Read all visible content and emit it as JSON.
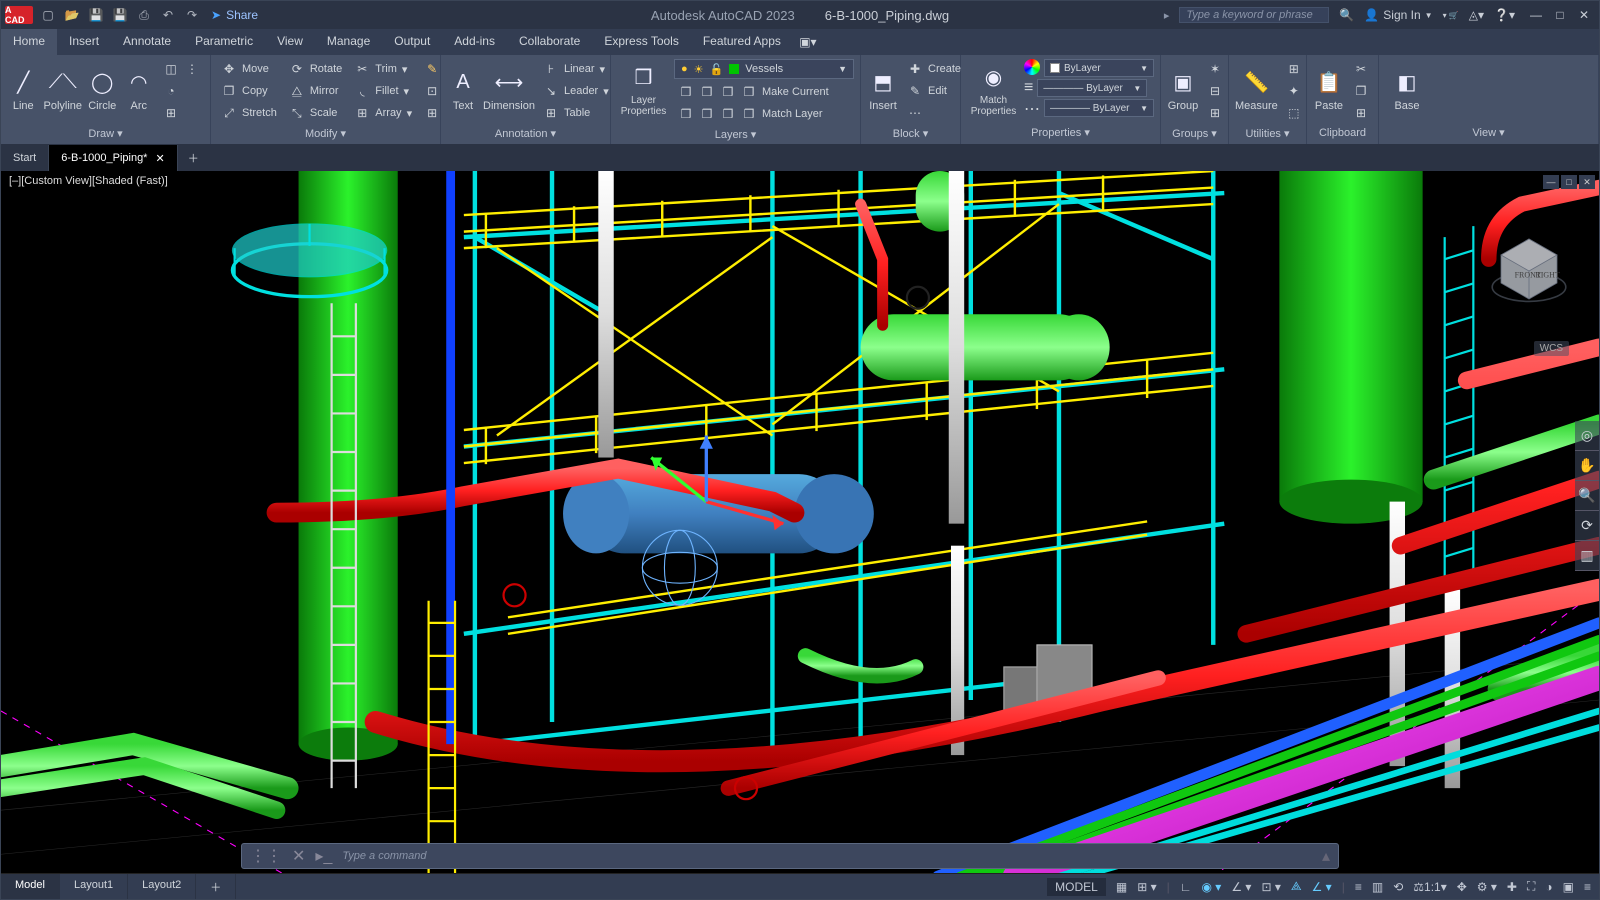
{
  "app": {
    "vendor": "Autodesk AutoCAD 2023",
    "filename": "6-B-1000_Piping.dwg"
  },
  "title": {
    "logo": "A CAD",
    "share": "Share",
    "search_ph": "Type a keyword or phrase",
    "signin": "Sign In"
  },
  "menutabs": [
    "Home",
    "Insert",
    "Annotate",
    "Parametric",
    "View",
    "Manage",
    "Output",
    "Add-ins",
    "Collaborate",
    "Express Tools",
    "Featured Apps"
  ],
  "ribbon": {
    "draw": {
      "label": "Draw ▾",
      "line": "Line",
      "polyline": "Polyline",
      "circle": "Circle",
      "arc": "Arc"
    },
    "modify": {
      "label": "Modify ▾",
      "move": "Move",
      "copy": "Copy",
      "stretch": "Stretch",
      "rotate": "Rotate",
      "mirror": "Mirror",
      "scale": "Scale",
      "trim": "Trim",
      "fillet": "Fillet",
      "array": "Array"
    },
    "annot": {
      "label": "Annotation ▾",
      "text": "Text",
      "dim": "Dimension",
      "linear": "Linear",
      "leader": "Leader",
      "table": "Table"
    },
    "layers": {
      "label": "Layers ▾",
      "props": "Layer\nProperties",
      "current": "Vessels",
      "makecur": "Make Current",
      "matchlayer": "Match Layer"
    },
    "block": {
      "label": "Block ▾",
      "insert": "Insert",
      "create": "Create",
      "edit": "Edit"
    },
    "props": {
      "label": "Properties ▾",
      "match": "Match\nProperties",
      "bylayer": "ByLayer"
    },
    "groups": {
      "label": "Groups ▾",
      "group": "Group"
    },
    "utils": {
      "label": "Utilities ▾",
      "measure": "Measure"
    },
    "clip": {
      "label": "Clipboard",
      "paste": "Paste"
    },
    "view": {
      "label": "View ▾",
      "base": "Base"
    }
  },
  "filetabs": {
    "start": "Start",
    "active": "6-B-1000_Piping*"
  },
  "viewport": {
    "label": "[–][Custom View][Shaded (Fast)]",
    "wcs": "WCS",
    "cube_front": "FRONT",
    "cube_right": "RIGHT"
  },
  "cmd": {
    "placeholder": "Type a command"
  },
  "bottomtabs": {
    "model": "Model",
    "l1": "Layout1",
    "l2": "Layout2"
  },
  "status": {
    "model": "MODEL",
    "scale": "1:1"
  }
}
